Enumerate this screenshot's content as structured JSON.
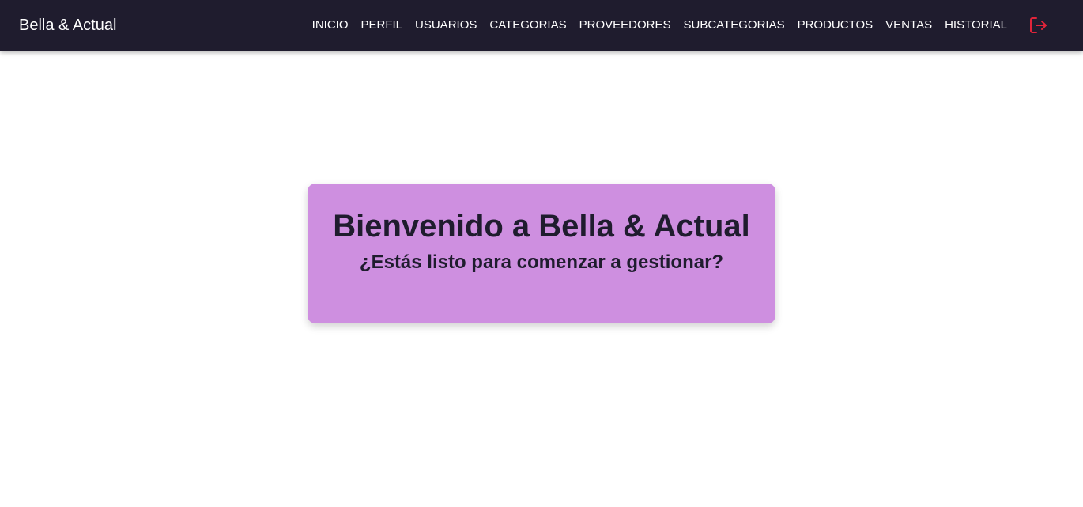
{
  "navbar": {
    "brand": "Bella & Actual",
    "links": [
      {
        "label": "INICIO"
      },
      {
        "label": "PERFIL"
      },
      {
        "label": "USUARIOS"
      },
      {
        "label": "CATEGORIAS"
      },
      {
        "label": "PROVEEDORES"
      },
      {
        "label": "SUBCATEGORIAS"
      },
      {
        "label": "PRODUCTOS"
      },
      {
        "label": "VENTAS"
      },
      {
        "label": "HISTORIAL"
      }
    ],
    "logout_icon": "logout-icon",
    "logout_icon_color": "#e0243a",
    "background_color": "#1f1c2e"
  },
  "main": {
    "title": "Bienvenido a Bella & Actual",
    "subtitle": "¿Estás listo para comenzar a gestionar?",
    "card_color": "#ce8fe0"
  }
}
